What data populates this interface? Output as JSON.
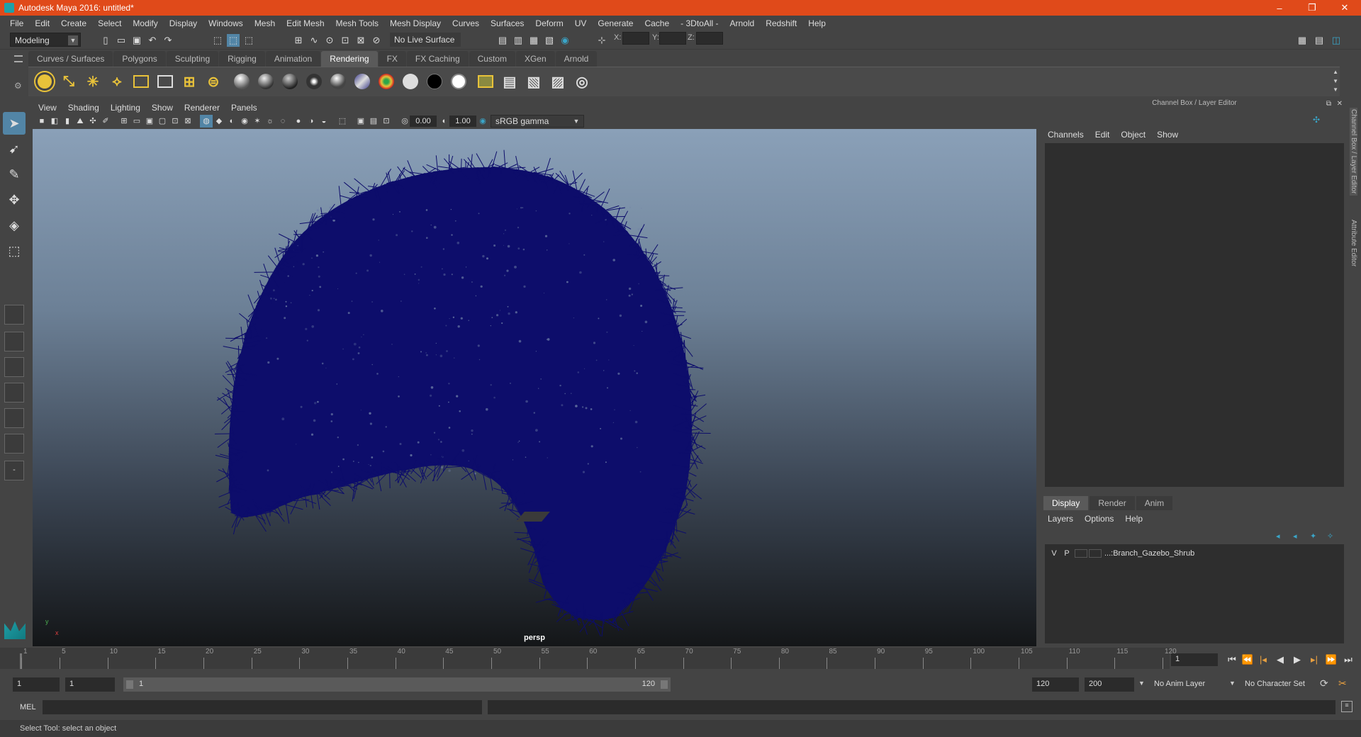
{
  "titlebar": {
    "title": "Autodesk Maya 2016: untitled*",
    "minimize": "–",
    "restore": "❐",
    "close": "✕"
  },
  "menus": [
    "File",
    "Edit",
    "Create",
    "Select",
    "Modify",
    "Display",
    "Windows",
    "Mesh",
    "Edit Mesh",
    "Mesh Tools",
    "Mesh Display",
    "Curves",
    "Surfaces",
    "Deform",
    "UV",
    "Generate",
    "Cache",
    "- 3DtoAll -",
    "Arnold",
    "Redshift",
    "Help"
  ],
  "statusline": {
    "menuset": "Modeling",
    "live_surface": "No Live Surface",
    "x_label": "X:",
    "y_label": "Y:",
    "z_label": "Z:"
  },
  "shelf_tabs": [
    "Curves / Surfaces",
    "Polygons",
    "Sculpting",
    "Rigging",
    "Animation",
    "Rendering",
    "FX",
    "FX Caching",
    "Custom",
    "XGen",
    "Arnold"
  ],
  "shelf_active": "Rendering",
  "viewport": {
    "menus": [
      "View",
      "Shading",
      "Lighting",
      "Show",
      "Renderer",
      "Panels"
    ],
    "exposure": "0.00",
    "gamma": "1.00",
    "colorspace": "sRGB gamma",
    "camera": "persp",
    "axis_y": "y",
    "axis_x": "x",
    "shrub_color": "#0d0d6b"
  },
  "channel_box": {
    "title": "Channel Box / Layer Editor",
    "menus": [
      "Channels",
      "Edit",
      "Object",
      "Show"
    ]
  },
  "layer_editor": {
    "tabs": [
      "Display",
      "Render",
      "Anim"
    ],
    "active_tab": "Display",
    "menus": [
      "Layers",
      "Options",
      "Help"
    ],
    "layers": [
      {
        "v": "V",
        "p": "P",
        "name": "...:Branch_Gazebo_Shrub"
      }
    ]
  },
  "side_tabs": [
    "Channel Box / Layer Editor",
    "Attribute Editor"
  ],
  "timeline": {
    "ticks": [
      1,
      5,
      10,
      15,
      20,
      25,
      30,
      35,
      40,
      45,
      50,
      55,
      60,
      65,
      70,
      75,
      80,
      85,
      90,
      95,
      100,
      105,
      110,
      115,
      120
    ],
    "current_frame": "1"
  },
  "range": {
    "start": "1",
    "playback_start": "1",
    "slider_start": "1",
    "slider_end": "120",
    "playback_end": "120",
    "end": "200",
    "anim_layer": "No Anim Layer",
    "character_set": "No Character Set"
  },
  "command": {
    "label": "MEL"
  },
  "help_line": "Select Tool: select an object",
  "colors": {
    "title_bar": "#e04a1a",
    "active_tool": "#5285a6",
    "light_icon": "#e8c23a"
  }
}
